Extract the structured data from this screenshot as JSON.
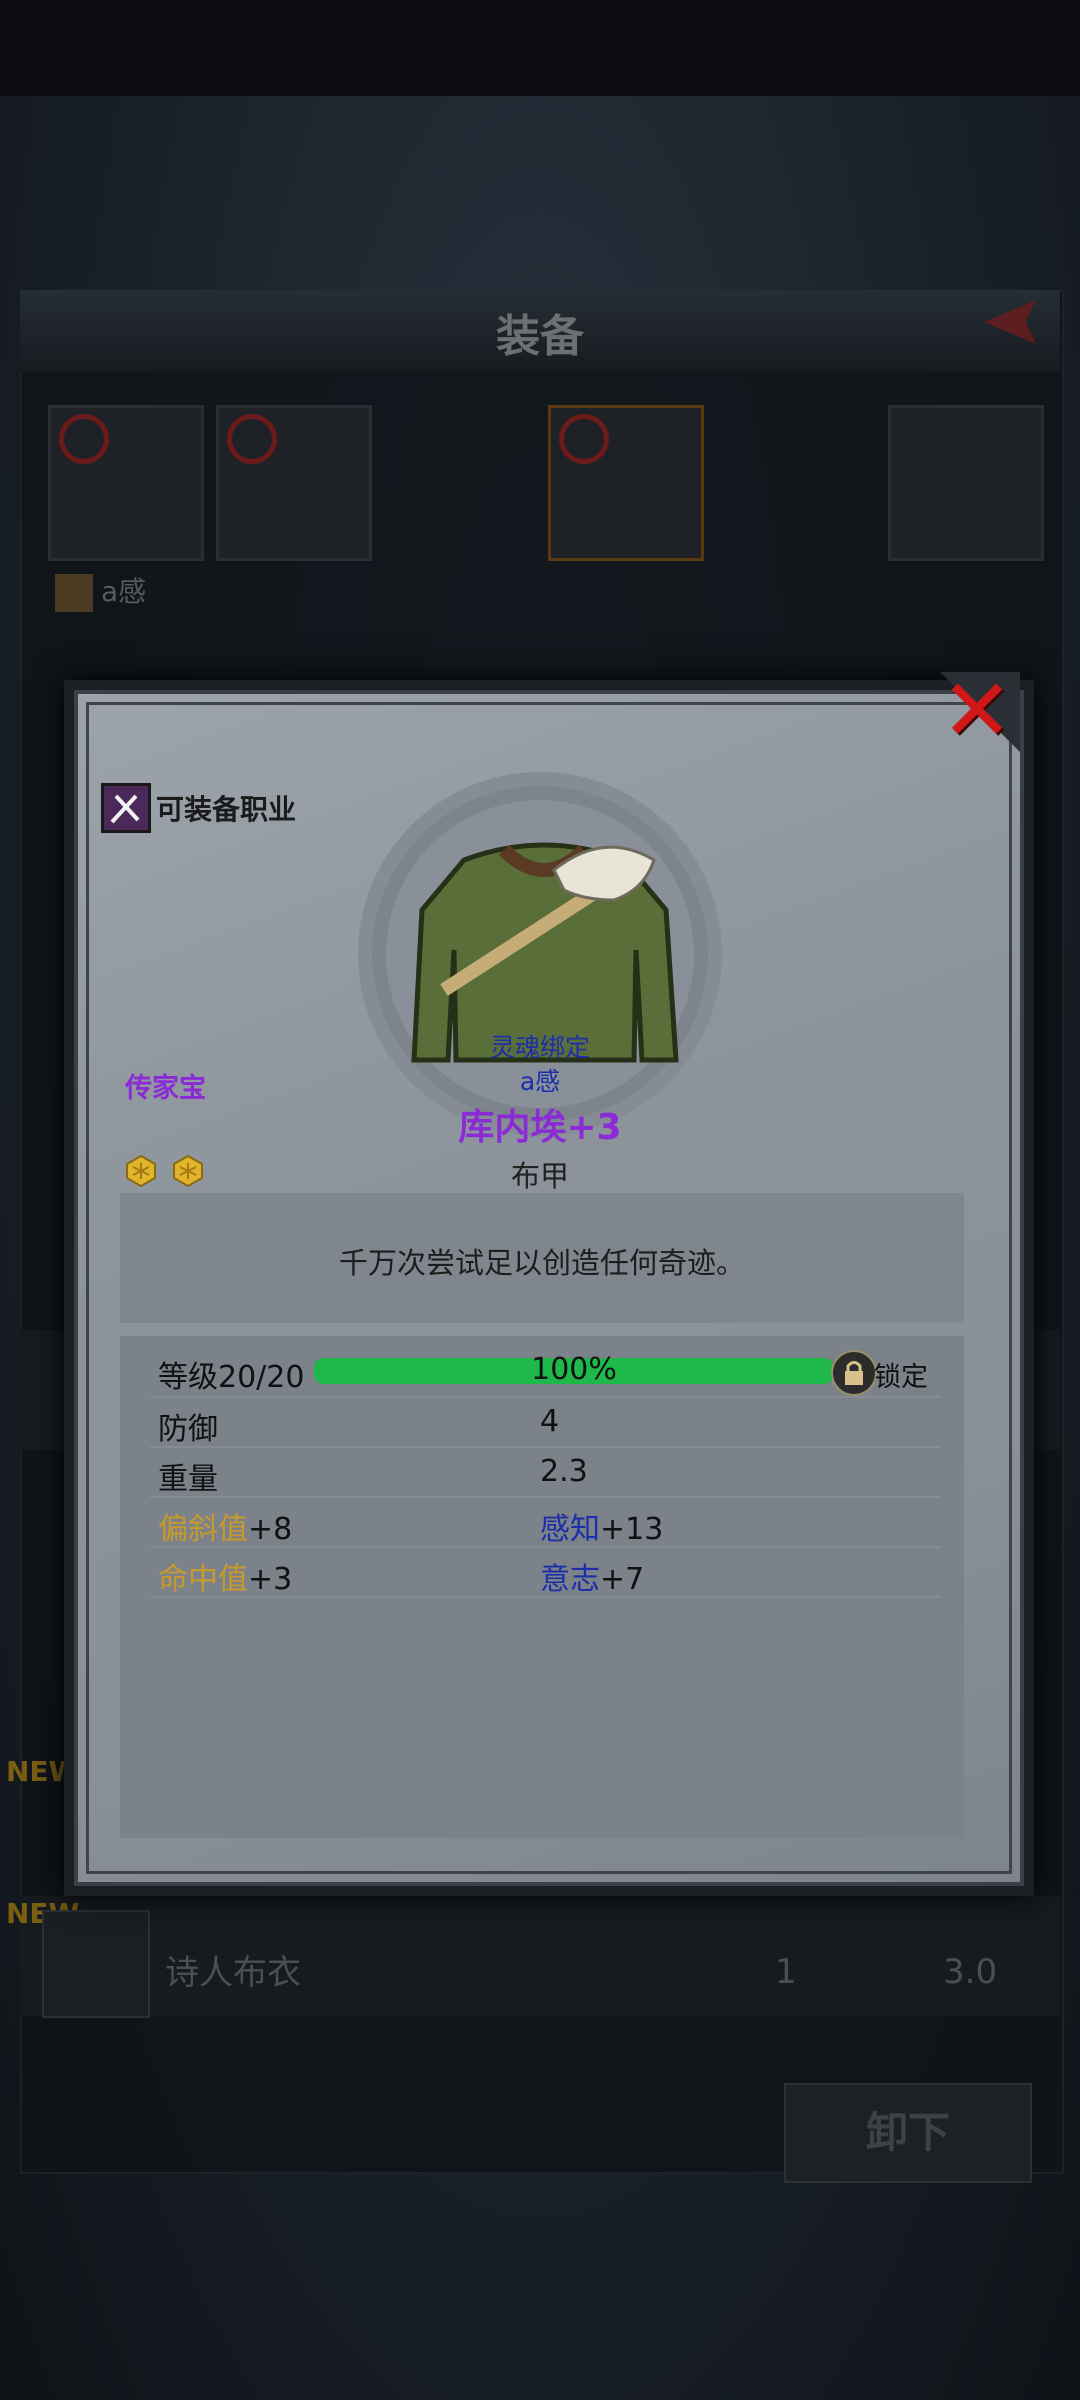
{
  "background": {
    "title": "装备",
    "character_name": "a感",
    "new_badge": "NEW",
    "new_badge_2": "NEW",
    "list_item": {
      "name": "诗人布衣",
      "count": "1",
      "weight": "3.0"
    },
    "unequip_button": "卸下"
  },
  "dialog": {
    "close_icon": "close-x-icon",
    "class_label": "可装备职业",
    "rarity": "传家宝",
    "soulbound": "灵魂绑定",
    "owner": "a感",
    "item_name": "库内埃+3",
    "item_type": "布甲",
    "description": "千万次尝试足以创造任何奇迹。",
    "level": {
      "label": "等级",
      "value": "20/20",
      "percent_text": "100%",
      "progress": 1.0,
      "lock_label": "锁定"
    },
    "stats": {
      "defense_label": "防御",
      "defense_value": "4",
      "weight_label": "重量",
      "weight_value": "2.3",
      "bias_label": "偏斜值",
      "bias_value": "+8",
      "perception_label": "感知",
      "perception_value": "+13",
      "hit_label": "命中值",
      "hit_value": "+3",
      "will_label": "意志",
      "will_value": "+7"
    }
  },
  "colors": {
    "accent_green": "#1eb84b",
    "rarity_purple": "#8a2bd6",
    "close_red": "#d01818",
    "bound_blue": "#1c2fa8",
    "stat_gold": "#c89a2c"
  }
}
